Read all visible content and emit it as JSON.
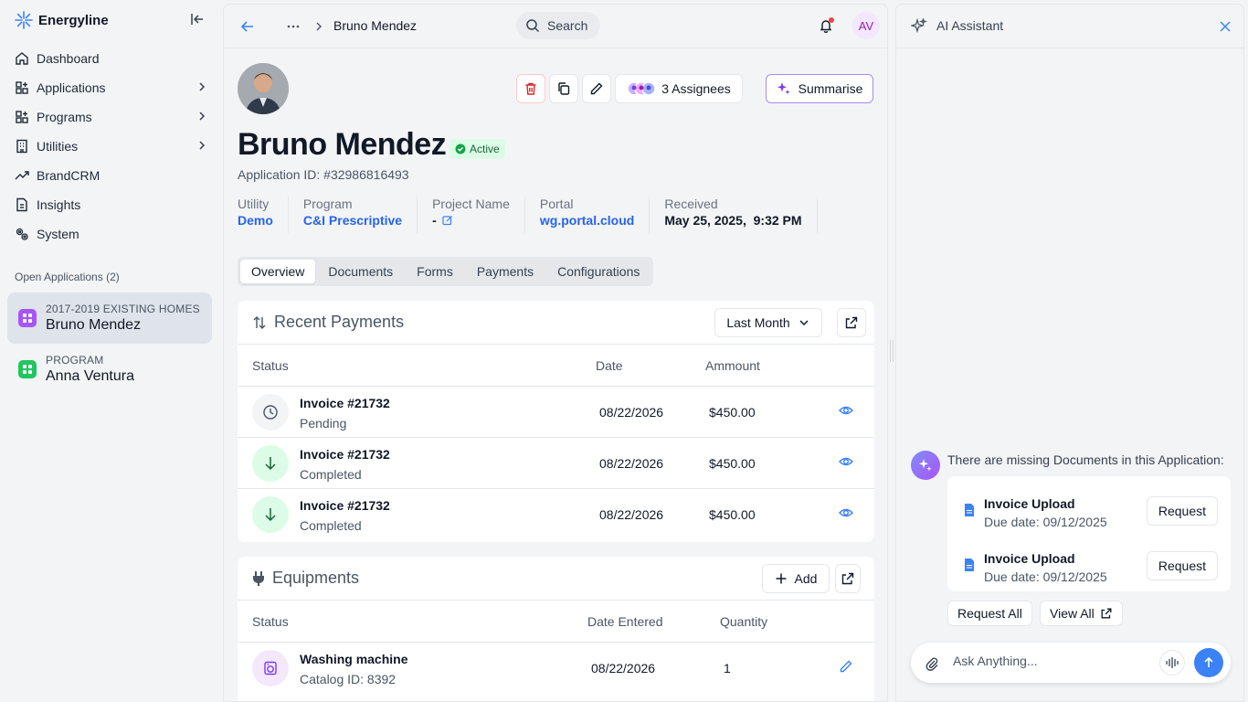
{
  "brand": {
    "name": "Energyline"
  },
  "sidebar": {
    "items": [
      {
        "label": "Dashboard",
        "icon": "home-icon"
      },
      {
        "label": "Applications",
        "icon": "apps-grid-icon"
      },
      {
        "label": "Programs",
        "icon": "apps-grid-icon"
      },
      {
        "label": "Utilities",
        "icon": "building-icon"
      },
      {
        "label": "BrandCRM",
        "icon": "trend-up-icon"
      },
      {
        "label": "Insights",
        "icon": "document-icon"
      },
      {
        "label": "System",
        "icon": "gears-icon"
      }
    ],
    "open_apps_label": "Open Applications (2)",
    "open_apps": [
      {
        "sub": "2017-2019 EXISTING HOMES",
        "title": "Bruno Mendez",
        "color": "#a855f7"
      },
      {
        "sub": "PROGRAM",
        "title": "Anna Ventura",
        "color": "#22c55e"
      }
    ]
  },
  "topbar": {
    "breadcrumb_current": "Bruno Mendez",
    "search_label": "Search",
    "avatar_initials": "AV"
  },
  "header": {
    "assignees_label": "3 Assignees",
    "summarise_label": "Summarise",
    "name": "Bruno Mendez",
    "status": "Active",
    "application_id": "Application ID: #32986816493"
  },
  "meta": [
    {
      "label": "Utility",
      "value": "Demo"
    },
    {
      "label": "Program",
      "value": "C&I Prescriptive"
    },
    {
      "label": "Project Name",
      "value": "-"
    },
    {
      "label": "Portal",
      "value": "wg.portal.cloud"
    },
    {
      "label": "Received",
      "value": "May 25, 2025,  9:32 PM"
    }
  ],
  "tabs": [
    "Overview",
    "Documents",
    "Forms",
    "Payments",
    "Configurations"
  ],
  "payments": {
    "title": "Recent Payments",
    "filter": "Last Month",
    "columns": [
      "Status",
      "Date",
      "Ammount"
    ],
    "rows": [
      {
        "invoice": "Invoice #21732",
        "status": "Pending",
        "date": "08/22/2026",
        "amount": "$450.00"
      },
      {
        "invoice": "Invoice #21732",
        "status": "Completed",
        "date": "08/22/2026",
        "amount": "$450.00"
      },
      {
        "invoice": "Invoice #21732",
        "status": "Completed",
        "date": "08/22/2026",
        "amount": "$450.00"
      }
    ]
  },
  "equipments": {
    "title": "Equipments",
    "add_label": "Add",
    "columns": [
      "Status",
      "Date Entered",
      "Quantity"
    ],
    "rows": [
      {
        "name": "Washing machine",
        "catalog": "Catalog ID: 8392",
        "date": "08/22/2026",
        "quantity": "1"
      }
    ]
  },
  "assistant": {
    "title": "AI Assistant",
    "message": "There are missing Documents in this Application:",
    "documents": [
      {
        "name": "Invoice Upload",
        "due": "Due date: 09/12/2025",
        "action": "Request"
      },
      {
        "name": "Invoice Upload",
        "due": "Due date: 09/12/2025",
        "action": "Request"
      }
    ],
    "request_all": "Request All",
    "view_all": "View All",
    "input_placeholder": "Ask Anything..."
  },
  "colors": {
    "accent": "#3b82f6",
    "link": "#2563eb",
    "success": "#16a34a",
    "danger": "#dc2626",
    "purple": "#a855f7"
  }
}
